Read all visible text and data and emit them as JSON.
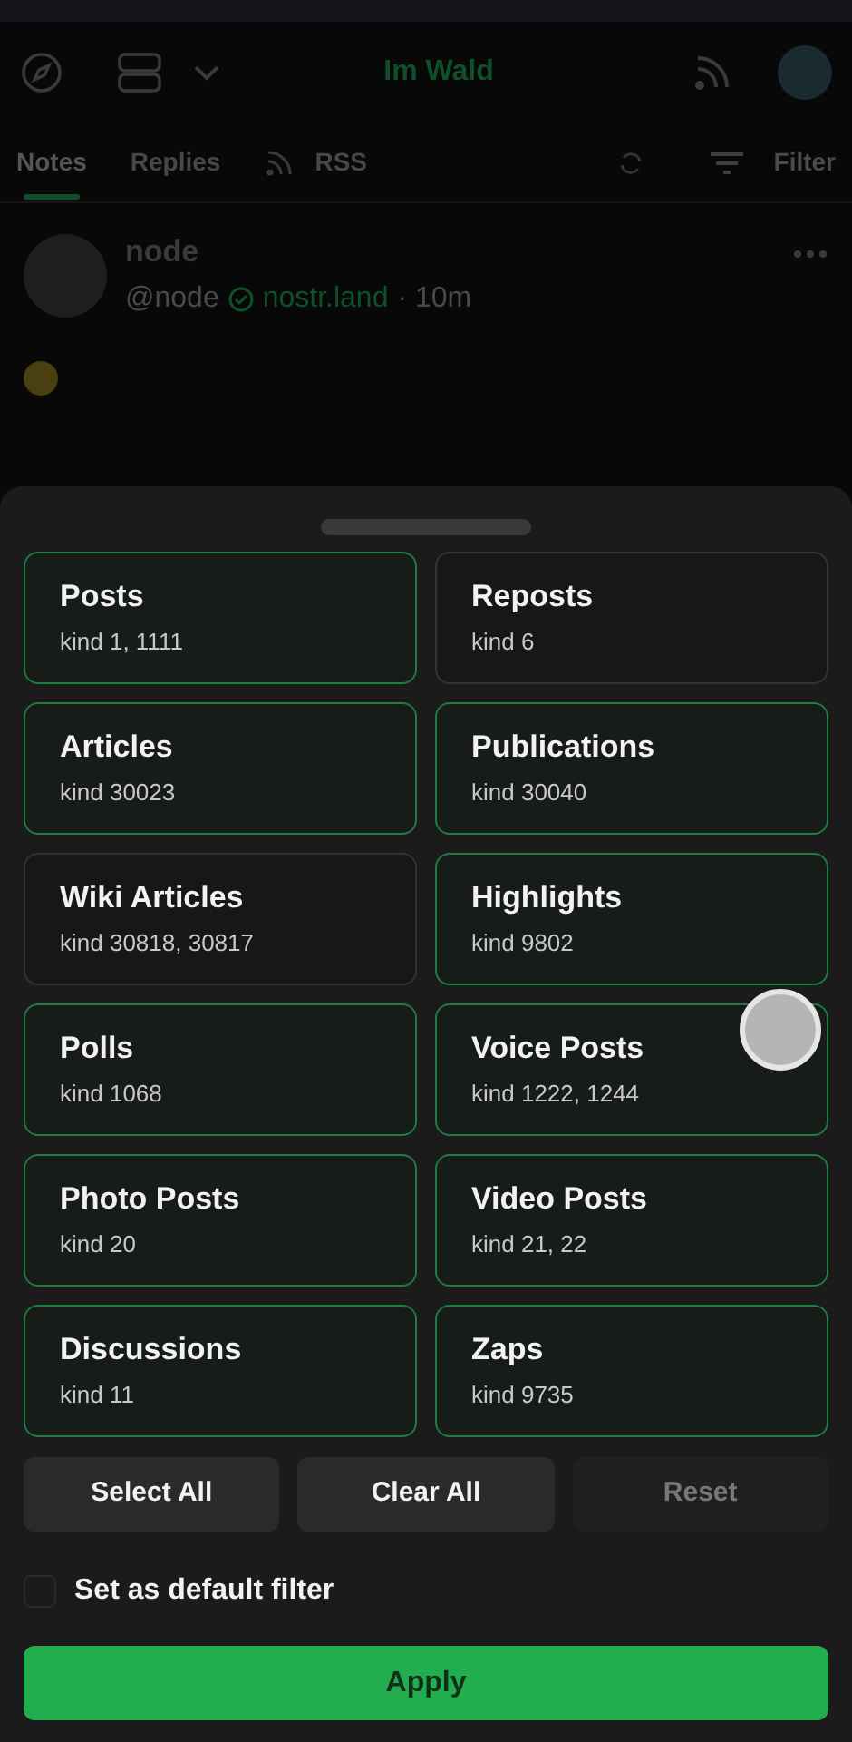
{
  "header": {
    "title": "Im Wald"
  },
  "tabs": [
    {
      "label": "Notes",
      "selected": true
    },
    {
      "label": "Replies",
      "selected": false
    },
    {
      "label": "RSS",
      "selected": false,
      "kind": "rss"
    }
  ],
  "filter_button": {
    "label": "Filter"
  },
  "post": {
    "author": "node",
    "handle": "@node",
    "domain": "nostr.land",
    "time": "· 10m"
  },
  "filter_sheet": {
    "categories": [
      {
        "title": "Posts",
        "kinds": "kind 1, 1111",
        "selected": true
      },
      {
        "title": "Reposts",
        "kinds": "kind 6",
        "selected": false
      },
      {
        "title": "Articles",
        "kinds": "kind 30023",
        "selected": true
      },
      {
        "title": "Publications",
        "kinds": "kind 30040",
        "selected": true
      },
      {
        "title": "Wiki Articles",
        "kinds": "kind 30818, 30817",
        "selected": false
      },
      {
        "title": "Highlights",
        "kinds": "kind 9802",
        "selected": true
      },
      {
        "title": "Polls",
        "kinds": "kind 1068",
        "selected": true
      },
      {
        "title": "Voice Posts",
        "kinds": "kind 1222, 1244",
        "selected": true
      },
      {
        "title": "Photo Posts",
        "kinds": "kind 20",
        "selected": true
      },
      {
        "title": "Video Posts",
        "kinds": "kind 21, 22",
        "selected": true
      },
      {
        "title": "Discussions",
        "kinds": "kind 11",
        "selected": true
      },
      {
        "title": "Zaps",
        "kinds": "kind 9735",
        "selected": true
      }
    ],
    "actions": [
      {
        "label": "Select All",
        "disabled": false
      },
      {
        "label": "Clear All",
        "disabled": false
      },
      {
        "label": "Reset",
        "disabled": true
      }
    ],
    "default_filter": {
      "label": "Set as default filter",
      "checked": false
    },
    "apply": {
      "label": "Apply"
    }
  }
}
